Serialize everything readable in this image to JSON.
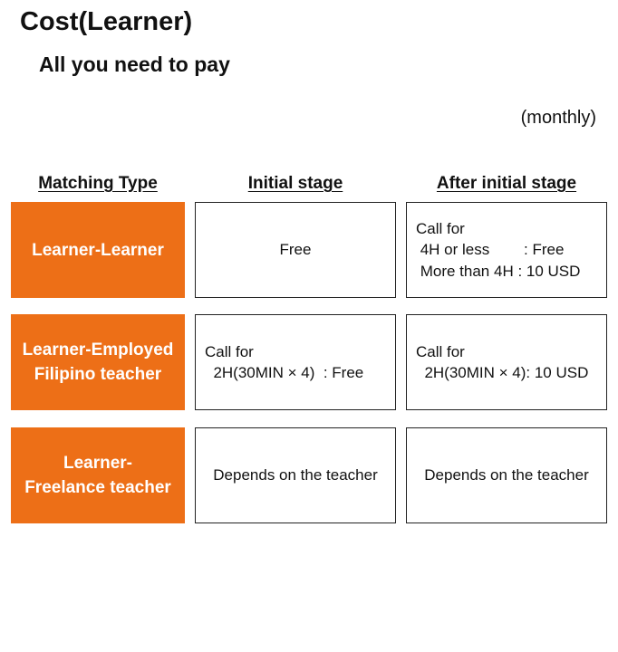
{
  "title": "Cost(Learner)",
  "subtitle": "All you need to pay",
  "period": "(monthly)",
  "headers": {
    "matching_type": "Matching Type",
    "initial_stage": "Initial stage",
    "after_initial_stage": "After initial stage"
  },
  "rows": [
    {
      "type_lines": [
        "Learner-Learner"
      ],
      "initial": [
        "Free"
      ],
      "after": [
        "Call for",
        " 4H or less        : Free",
        " More than 4H : 10 USD"
      ]
    },
    {
      "type_lines": [
        "Learner-Employed",
        "Filipino teacher"
      ],
      "initial": [
        "Call for",
        "  2H(30MIN × 4)  : Free"
      ],
      "after": [
        "Call for",
        "  2H(30MIN × 4): 10 USD"
      ]
    },
    {
      "type_lines": [
        "Learner-",
        "Freelance teacher"
      ],
      "initial": [
        "Depends on the teacher"
      ],
      "after": [
        "Depends on the teacher"
      ]
    }
  ],
  "colors": {
    "accent": "#ed6f17",
    "border": "#222222",
    "text": "#111111"
  }
}
